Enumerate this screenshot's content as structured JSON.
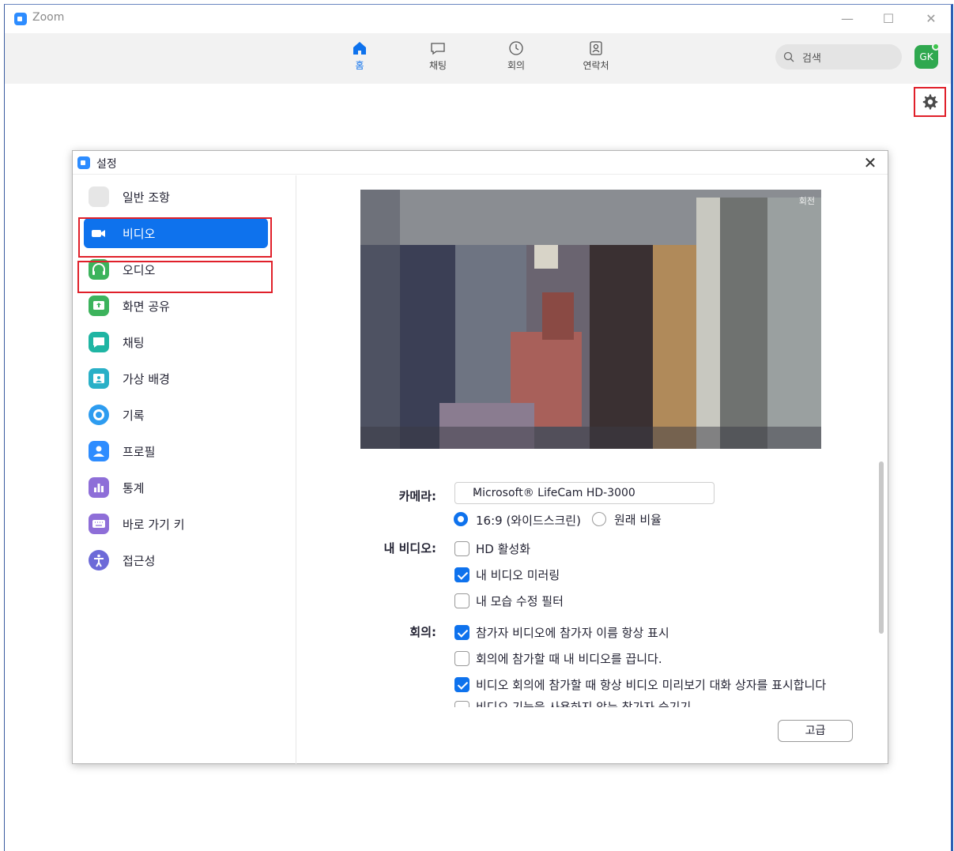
{
  "window": {
    "title": "Zoom"
  },
  "nav": {
    "tabs": [
      {
        "label": "홈",
        "icon": "home-icon",
        "active": true
      },
      {
        "label": "채팅",
        "icon": "chat-icon"
      },
      {
        "label": "회의",
        "icon": "clock-icon"
      },
      {
        "label": "연락처",
        "icon": "contacts-icon"
      }
    ],
    "search_placeholder": "검색",
    "avatar_initials": "GK"
  },
  "settings": {
    "title": "설정",
    "sidebar": [
      {
        "label": "일반 조항",
        "icon": "gear-icon",
        "color": "#d9d9d9"
      },
      {
        "label": "비디오",
        "icon": "video-camera-icon",
        "color": "#0e72ed",
        "active": true
      },
      {
        "label": "오디오",
        "icon": "headphones-icon",
        "color": "#3cb35c"
      },
      {
        "label": "화면 공유",
        "icon": "share-screen-icon",
        "color": "#3cb35c"
      },
      {
        "label": "채팅",
        "icon": "chat-bubble-icon",
        "color": "#1fb5a3"
      },
      {
        "label": "가상 배경",
        "icon": "virtual-background-icon",
        "color": "#2ab0c7"
      },
      {
        "label": "기록",
        "icon": "record-icon",
        "color": "#2d9cf0"
      },
      {
        "label": "프로필",
        "icon": "profile-icon",
        "color": "#2d8cff"
      },
      {
        "label": "통계",
        "icon": "statistics-icon",
        "color": "#8e6ed8"
      },
      {
        "label": "바로 가기 키",
        "icon": "keyboard-icon",
        "color": "#8e6ed8"
      },
      {
        "label": "접근성",
        "icon": "accessibility-icon",
        "color": "#6d6ad8"
      }
    ],
    "video": {
      "preview_label": "회전",
      "camera_label": "카메라:",
      "camera_value": "Microsoft® LifeCam HD-3000",
      "aspect_options": [
        {
          "label": "16:9 (와이드스크린)",
          "checked": true
        },
        {
          "label": "원래 비율",
          "checked": false
        }
      ],
      "my_video_label": "내 비디오:",
      "my_video_options": [
        {
          "label": "HD 활성화",
          "checked": false
        },
        {
          "label": "내 비디오 미러링",
          "checked": true
        },
        {
          "label": "내 모습 수정 필터",
          "checked": false
        }
      ],
      "meeting_label": "회의:",
      "meeting_options": [
        {
          "label": "참가자 비디오에 참가자 이름 항상 표시",
          "checked": true
        },
        {
          "label": "회의에 참가할 때 내 비디오를 끕니다.",
          "checked": false
        },
        {
          "label": "비디오 회의에 참가할 때 항상 비디오 미리보기 대화 상자를 표시합니다",
          "checked": true
        },
        {
          "label": "비디오 기능을 사용하지 않는 참가자 숨기기",
          "checked": false
        }
      ],
      "advanced_button": "고급"
    }
  },
  "highlight_color": "#e0202a"
}
